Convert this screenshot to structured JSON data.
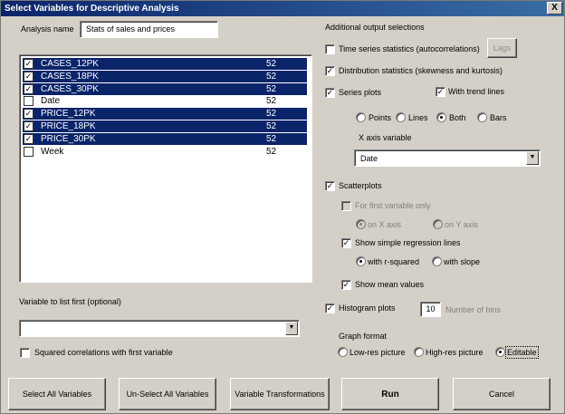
{
  "window": {
    "title": "Select Variables for Descriptive Analysis",
    "close_glyph": "X"
  },
  "analysis_name": {
    "label": "Analysis name",
    "value": "Stats of sales and prices"
  },
  "variables": [
    {
      "name": "CASES_12PK",
      "count": "52",
      "checked": true,
      "selected": true
    },
    {
      "name": "CASES_18PK",
      "count": "52",
      "checked": true,
      "selected": true
    },
    {
      "name": "CASES_30PK",
      "count": "52",
      "checked": true,
      "selected": true
    },
    {
      "name": "Date",
      "count": "52",
      "checked": false,
      "selected": false
    },
    {
      "name": "PRICE_12PK",
      "count": "52",
      "checked": true,
      "selected": true
    },
    {
      "name": "PRICE_18PK",
      "count": "52",
      "checked": true,
      "selected": true
    },
    {
      "name": "PRICE_30PK",
      "count": "52",
      "checked": true,
      "selected": true
    },
    {
      "name": "Week",
      "count": "52",
      "checked": false,
      "selected": false
    }
  ],
  "first_variable": {
    "label": "Variable to list first (optional)",
    "value": ""
  },
  "squared_correlations": {
    "label": "Squared correlations with first variable",
    "checked": false
  },
  "options": {
    "header": "Additional output selections",
    "time_series": {
      "label": "Time series statistics (autocorrelations)",
      "checked": false
    },
    "lags_button": "Lags",
    "distribution": {
      "label": "Distribution statistics (skewness and kurtosis)",
      "checked": true
    },
    "series_plots": {
      "label": "Series plots",
      "checked": true
    },
    "trend_lines": {
      "label": "With trend lines",
      "checked": true
    },
    "plot_style": {
      "points": "Points",
      "lines": "Lines",
      "both": "Both",
      "bars": "Bars",
      "selected": "both"
    },
    "x_axis": {
      "label": "X axis variable",
      "value": "Date"
    },
    "scatterplots": {
      "label": "Scatterplots",
      "checked": true
    },
    "first_only": {
      "label": "For first variable only",
      "checked": false
    },
    "axis_choice": {
      "on_x": "on X axis",
      "on_y": "on Y axis",
      "selected": "on_x"
    },
    "regression_lines": {
      "label": "Show simple regression lines",
      "checked": true
    },
    "regression_detail": {
      "r_squared": "with r-squared",
      "slope": "with slope",
      "selected": "r_squared"
    },
    "mean_values": {
      "label": "Show mean values",
      "checked": true
    },
    "histograms": {
      "label": "Histogram plots",
      "checked": true
    },
    "bins": {
      "value": "10",
      "label": "Number of bins"
    },
    "graph_format": {
      "label": "Graph format",
      "low": "Low-res picture",
      "high": "High-res picture",
      "editable": "Editable",
      "selected": "editable"
    }
  },
  "buttons": {
    "select_all": "Select All Variables",
    "unselect_all": "Un-Select All Variables",
    "transformations": "Variable Transformations",
    "run": "Run",
    "cancel": "Cancel"
  },
  "glyphs": {
    "check": "✓",
    "dropdown": "▼"
  }
}
